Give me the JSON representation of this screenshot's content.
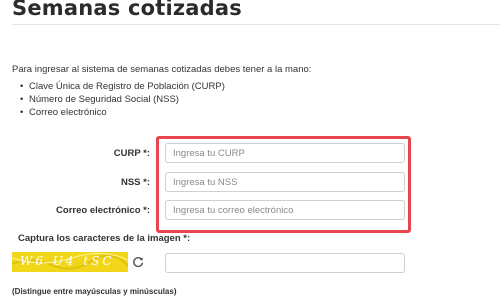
{
  "page": {
    "title": "Semanas cotizadas"
  },
  "intro": {
    "text": "Para ingresar al sistema de semanas cotizadas debes tener a la mano:",
    "items": [
      "Clave Única de Registro de Población (CURP)",
      "Número de Seguridad Social (NSS)",
      "Correo electrónico"
    ]
  },
  "form": {
    "curp": {
      "label": "CURP *:",
      "placeholder": "Ingresa tu CURP",
      "value": ""
    },
    "nss": {
      "label": "NSS *:",
      "placeholder": "Ingresa tu NSS",
      "value": ""
    },
    "email": {
      "label": "Correo electrónico *:",
      "placeholder": "Ingresa tu correo electrónico",
      "value": ""
    }
  },
  "captcha": {
    "label": "Captura los caracteres de la imagen *:",
    "image_text": "W6 U4 tSC",
    "value": "",
    "refresh_icon": "refresh-icon",
    "note": "(Distingue entre mayúsculas y minúsculas)"
  },
  "colors": {
    "highlight": "#e8464e",
    "captcha_bg": "#f2d61a"
  }
}
